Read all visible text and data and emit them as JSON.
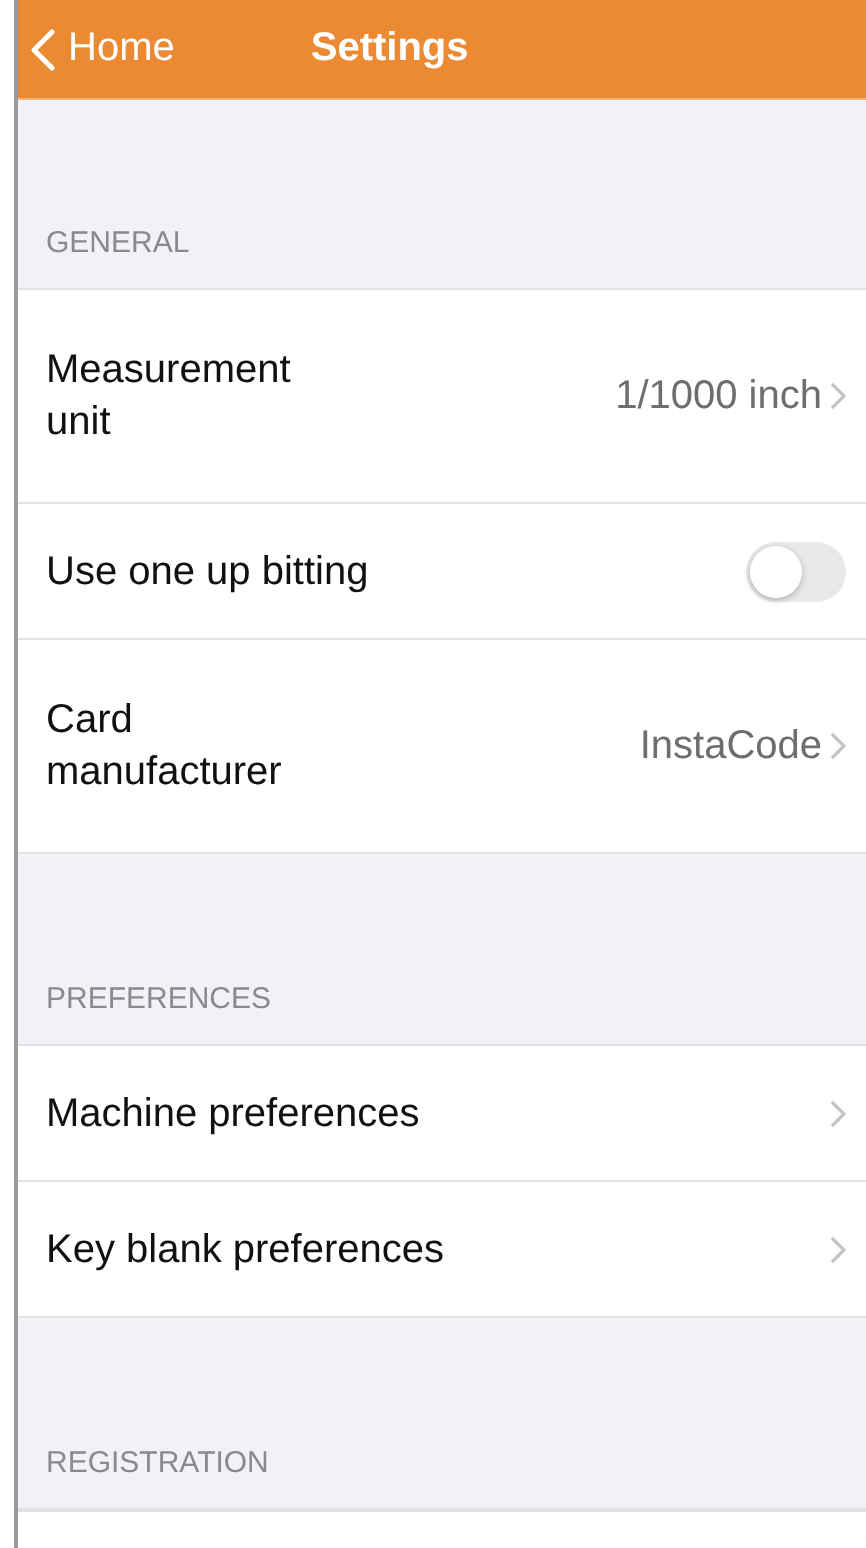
{
  "nav_bar": {
    "back_label": "Home",
    "title": "Settings"
  },
  "sections": [
    {
      "header": "GENERAL",
      "rows": [
        {
          "kind": "value",
          "label": "Measurement unit",
          "value": "1/1000 inch"
        },
        {
          "kind": "toggle",
          "label": "Use one up bitting",
          "on": false
        },
        {
          "kind": "value",
          "label": "Card manufacturer",
          "value": "InstaCode"
        }
      ]
    },
    {
      "header": "PREFERENCES",
      "rows": [
        {
          "kind": "link",
          "label": "Machine preferences"
        },
        {
          "kind": "link",
          "label": "Key blank preferences"
        }
      ]
    },
    {
      "header": "REGISTRATION"
    }
  ]
}
